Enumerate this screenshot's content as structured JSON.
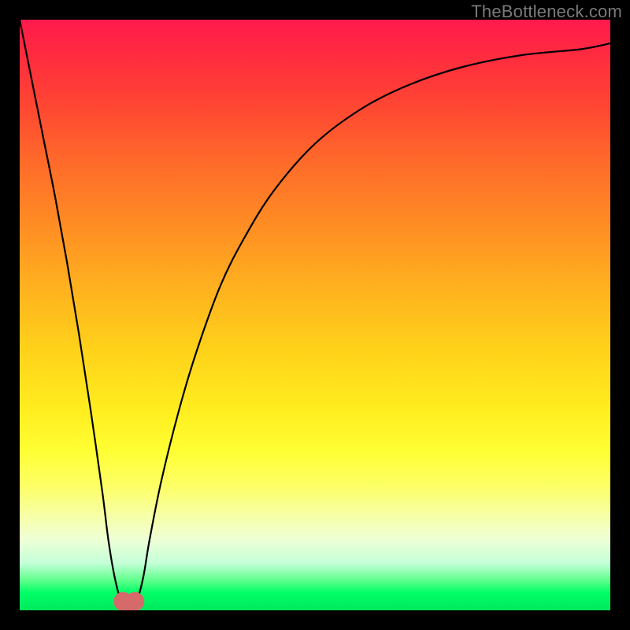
{
  "watermark": "TheBottleneck.com",
  "chart_data": {
    "type": "line",
    "title": "",
    "xlabel": "",
    "ylabel": "",
    "xlim": [
      0,
      100
    ],
    "ylim": [
      0,
      100
    ],
    "series": [
      {
        "name": "bottleneck-curve",
        "x": [
          0,
          2,
          4,
          6,
          8,
          10,
          12,
          14,
          15,
          16,
          17,
          18,
          19,
          20,
          21,
          22,
          24,
          27,
          30,
          34,
          38,
          43,
          50,
          58,
          66,
          75,
          85,
          95,
          100
        ],
        "values": [
          100,
          90,
          80,
          70,
          59,
          47,
          34,
          20,
          12,
          6,
          2,
          0,
          0,
          2,
          6,
          12,
          22,
          34,
          44,
          55,
          63,
          71,
          79,
          85,
          89,
          92,
          94,
          95,
          96
        ]
      }
    ],
    "markers": [
      {
        "name": "valley-marker-left",
        "x": 17.5,
        "y": 1.5,
        "color": "#d46a6a",
        "radius_pct": 1.6
      },
      {
        "name": "valley-marker-right",
        "x": 19.5,
        "y": 1.5,
        "color": "#d46a6a",
        "radius_pct": 1.6
      }
    ],
    "colors": {
      "curve": "#000000",
      "marker": "#d46a6a",
      "background_top": "#ff1a4d",
      "background_bottom": "#00e85c",
      "frame": "#000000",
      "watermark": "#7a7a7a"
    }
  }
}
